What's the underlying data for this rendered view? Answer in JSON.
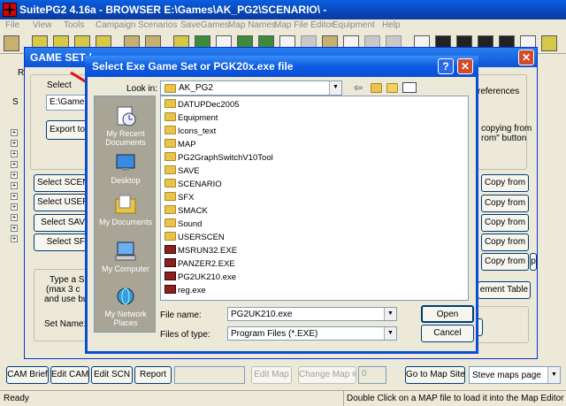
{
  "app": {
    "title": "SuitePG2 4.16a  -  BROWSER  E:\\Games\\AK_PG2\\SCENARIO\\ -",
    "menu": [
      "File",
      "View",
      "Tools",
      "Campaign",
      "Scenarios",
      "SaveGames",
      "Map Names",
      "Map File Editor",
      "Equipment",
      "Help"
    ]
  },
  "gameset": {
    "title": "GAME SET  /",
    "close": "✕",
    "select_label": "Select",
    "path_value": "E:\\Games\\",
    "export_button": "Export to",
    "left_buttons": [
      "Select SCENA",
      "Select USERS",
      "Select SAV",
      "Select SF"
    ],
    "right_text_1": "references",
    "right_text_2": "copying from",
    "right_text_3": "rom\" button",
    "copy_buttons": [
      "Copy from",
      "Copy from",
      "Copy from",
      "Copy from",
      "Copy from"
    ],
    "copy_side": "p",
    "element_table": "ement Table",
    "type_text_1": "Type a Se",
    "type_text_2": "(max 3 c",
    "type_text_3": "and use but",
    "set_name_label": "Set Name:",
    "side_r": "Rr",
    "side_s": "S"
  },
  "dialog": {
    "title": "Select Exe Game Set or PGK20x.exe file",
    "help": "?",
    "close": "✕",
    "look_in_label": "Look in:",
    "look_in_value": "AK_PG2",
    "places": [
      "My Recent Documents",
      "Desktop",
      "My Documents",
      "My Computer",
      "My Network Places"
    ],
    "files": [
      {
        "name": "DATUPDec2005",
        "type": "folder"
      },
      {
        "name": "Equipment",
        "type": "folder"
      },
      {
        "name": "Icons_text",
        "type": "folder"
      },
      {
        "name": "MAP",
        "type": "folder"
      },
      {
        "name": "PG2GraphSwitchV10Tool",
        "type": "folder"
      },
      {
        "name": "SAVE",
        "type": "folder"
      },
      {
        "name": "SCENARIO",
        "type": "folder"
      },
      {
        "name": "SFX",
        "type": "folder"
      },
      {
        "name": "SMACK",
        "type": "folder"
      },
      {
        "name": "Sound",
        "type": "folder"
      },
      {
        "name": "USERSCEN",
        "type": "folder"
      },
      {
        "name": "MSRUN32.EXE",
        "type": "exe"
      },
      {
        "name": "PANZER2.EXE",
        "type": "exe"
      },
      {
        "name": "PG2UK210.exe",
        "type": "exe"
      },
      {
        "name": "reg.exe",
        "type": "exe"
      }
    ],
    "file_name_label": "File name:",
    "file_name_value": "PG2UK210.exe",
    "files_of_type_label": "Files of type:",
    "files_of_type_value": "Program Files (*.EXE)",
    "open_button": "Open",
    "cancel_button": "Cancel"
  },
  "bottom": {
    "cam_brief": "CAM Brief",
    "edit_cam": "Edit CAM",
    "edit_scn": "Edit  SCN",
    "report": "Report",
    "edit_map": "Edit Map",
    "change_map": "Change Map #",
    "map_num": "0",
    "go_map_site": "Go to Map Site",
    "maps_page": "Steve maps page"
  },
  "status": {
    "left": "Ready",
    "right": "Double Click on a MAP file to load it into the Map Editor"
  },
  "colors": {
    "titlebar": "#0a52d6",
    "arrow": "#e01010",
    "face": "#ece9d8"
  }
}
